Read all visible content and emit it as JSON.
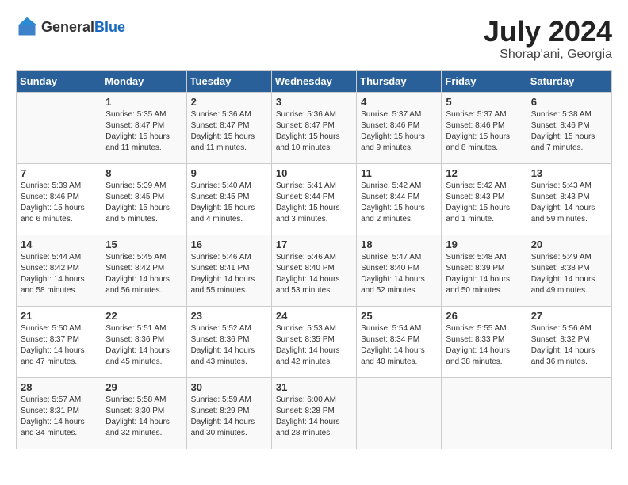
{
  "header": {
    "logo_general": "General",
    "logo_blue": "Blue",
    "month_year": "July 2024",
    "location": "Shorap'ani, Georgia"
  },
  "days_of_week": [
    "Sunday",
    "Monday",
    "Tuesday",
    "Wednesday",
    "Thursday",
    "Friday",
    "Saturday"
  ],
  "weeks": [
    [
      {
        "day": "",
        "info": ""
      },
      {
        "day": "1",
        "info": "Sunrise: 5:35 AM\nSunset: 8:47 PM\nDaylight: 15 hours\nand 11 minutes."
      },
      {
        "day": "2",
        "info": "Sunrise: 5:36 AM\nSunset: 8:47 PM\nDaylight: 15 hours\nand 11 minutes."
      },
      {
        "day": "3",
        "info": "Sunrise: 5:36 AM\nSunset: 8:47 PM\nDaylight: 15 hours\nand 10 minutes."
      },
      {
        "day": "4",
        "info": "Sunrise: 5:37 AM\nSunset: 8:46 PM\nDaylight: 15 hours\nand 9 minutes."
      },
      {
        "day": "5",
        "info": "Sunrise: 5:37 AM\nSunset: 8:46 PM\nDaylight: 15 hours\nand 8 minutes."
      },
      {
        "day": "6",
        "info": "Sunrise: 5:38 AM\nSunset: 8:46 PM\nDaylight: 15 hours\nand 7 minutes."
      }
    ],
    [
      {
        "day": "7",
        "info": "Sunrise: 5:39 AM\nSunset: 8:46 PM\nDaylight: 15 hours\nand 6 minutes."
      },
      {
        "day": "8",
        "info": "Sunrise: 5:39 AM\nSunset: 8:45 PM\nDaylight: 15 hours\nand 5 minutes."
      },
      {
        "day": "9",
        "info": "Sunrise: 5:40 AM\nSunset: 8:45 PM\nDaylight: 15 hours\nand 4 minutes."
      },
      {
        "day": "10",
        "info": "Sunrise: 5:41 AM\nSunset: 8:44 PM\nDaylight: 15 hours\nand 3 minutes."
      },
      {
        "day": "11",
        "info": "Sunrise: 5:42 AM\nSunset: 8:44 PM\nDaylight: 15 hours\nand 2 minutes."
      },
      {
        "day": "12",
        "info": "Sunrise: 5:42 AM\nSunset: 8:43 PM\nDaylight: 15 hours\nand 1 minute."
      },
      {
        "day": "13",
        "info": "Sunrise: 5:43 AM\nSunset: 8:43 PM\nDaylight: 14 hours\nand 59 minutes."
      }
    ],
    [
      {
        "day": "14",
        "info": "Sunrise: 5:44 AM\nSunset: 8:42 PM\nDaylight: 14 hours\nand 58 minutes."
      },
      {
        "day": "15",
        "info": "Sunrise: 5:45 AM\nSunset: 8:42 PM\nDaylight: 14 hours\nand 56 minutes."
      },
      {
        "day": "16",
        "info": "Sunrise: 5:46 AM\nSunset: 8:41 PM\nDaylight: 14 hours\nand 55 minutes."
      },
      {
        "day": "17",
        "info": "Sunrise: 5:46 AM\nSunset: 8:40 PM\nDaylight: 14 hours\nand 53 minutes."
      },
      {
        "day": "18",
        "info": "Sunrise: 5:47 AM\nSunset: 8:40 PM\nDaylight: 14 hours\nand 52 minutes."
      },
      {
        "day": "19",
        "info": "Sunrise: 5:48 AM\nSunset: 8:39 PM\nDaylight: 14 hours\nand 50 minutes."
      },
      {
        "day": "20",
        "info": "Sunrise: 5:49 AM\nSunset: 8:38 PM\nDaylight: 14 hours\nand 49 minutes."
      }
    ],
    [
      {
        "day": "21",
        "info": "Sunrise: 5:50 AM\nSunset: 8:37 PM\nDaylight: 14 hours\nand 47 minutes."
      },
      {
        "day": "22",
        "info": "Sunrise: 5:51 AM\nSunset: 8:36 PM\nDaylight: 14 hours\nand 45 minutes."
      },
      {
        "day": "23",
        "info": "Sunrise: 5:52 AM\nSunset: 8:36 PM\nDaylight: 14 hours\nand 43 minutes."
      },
      {
        "day": "24",
        "info": "Sunrise: 5:53 AM\nSunset: 8:35 PM\nDaylight: 14 hours\nand 42 minutes."
      },
      {
        "day": "25",
        "info": "Sunrise: 5:54 AM\nSunset: 8:34 PM\nDaylight: 14 hours\nand 40 minutes."
      },
      {
        "day": "26",
        "info": "Sunrise: 5:55 AM\nSunset: 8:33 PM\nDaylight: 14 hours\nand 38 minutes."
      },
      {
        "day": "27",
        "info": "Sunrise: 5:56 AM\nSunset: 8:32 PM\nDaylight: 14 hours\nand 36 minutes."
      }
    ],
    [
      {
        "day": "28",
        "info": "Sunrise: 5:57 AM\nSunset: 8:31 PM\nDaylight: 14 hours\nand 34 minutes."
      },
      {
        "day": "29",
        "info": "Sunrise: 5:58 AM\nSunset: 8:30 PM\nDaylight: 14 hours\nand 32 minutes."
      },
      {
        "day": "30",
        "info": "Sunrise: 5:59 AM\nSunset: 8:29 PM\nDaylight: 14 hours\nand 30 minutes."
      },
      {
        "day": "31",
        "info": "Sunrise: 6:00 AM\nSunset: 8:28 PM\nDaylight: 14 hours\nand 28 minutes."
      },
      {
        "day": "",
        "info": ""
      },
      {
        "day": "",
        "info": ""
      },
      {
        "day": "",
        "info": ""
      }
    ]
  ]
}
